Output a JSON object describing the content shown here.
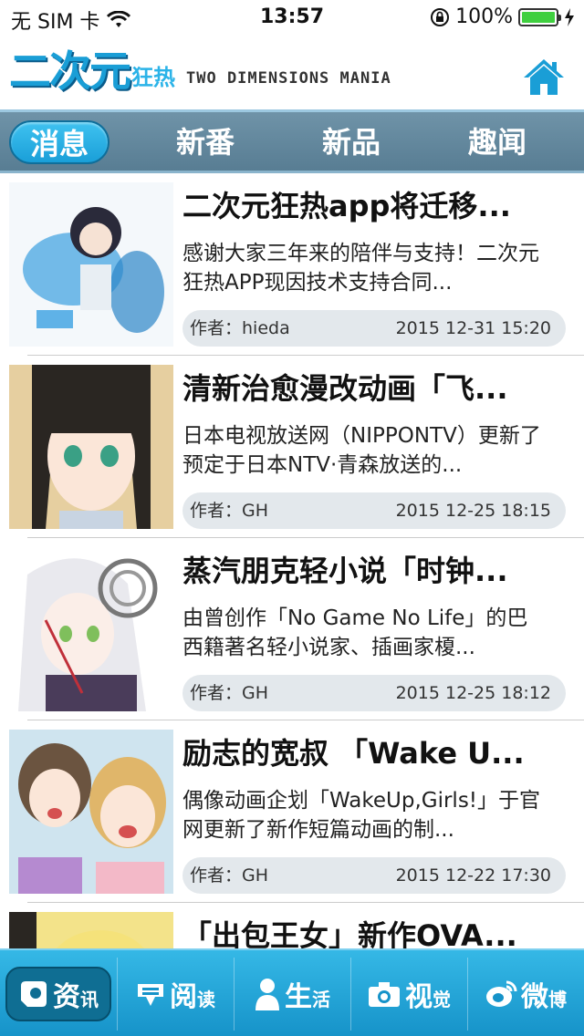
{
  "status_bar": {
    "carrier": "无 SIM 卡",
    "time": "13:57",
    "battery": "100%",
    "battery_level": 1.0
  },
  "header": {
    "logo_main": "二次元",
    "logo_sub": "狂热",
    "logo_en": "TWO DIMENSIONS MANIA",
    "home_icon": "home-icon"
  },
  "tabs": [
    {
      "label": "消息",
      "active": true
    },
    {
      "label": "新番",
      "active": false
    },
    {
      "label": "新品",
      "active": false
    },
    {
      "label": "趣闻",
      "active": false
    }
  ],
  "news": [
    {
      "title": "二次元狂热app将迁移...",
      "desc": "感谢大家三年来的陪伴与支持！二次元狂热APP现因技术支持合同...",
      "author": "作者：hieda",
      "date": "2015 12-31 15:20"
    },
    {
      "title": "清新治愈漫改动画「飞...",
      "desc": "日本电视放送网（NIPPONTV）更新了预定于日本NTV·青森放送的...",
      "author": "作者：GH",
      "date": "2015 12-25 18:15"
    },
    {
      "title": "蒸汽朋克轻小说「时钟...",
      "desc": "由曾创作「No Game No Life」的巴西籍著名轻小说家、插画家榎...",
      "author": "作者：GH",
      "date": "2015 12-25 18:12"
    },
    {
      "title": "励志的宽叔 「Wake U...",
      "desc": "偶像动画企划「WakeUp,Girls!」于官网更新了新作短篇动画的制...",
      "author": "作者：GH",
      "date": "2015 12-22 17:30"
    },
    {
      "title": "「出包王女」新作OVA...",
      "desc": "",
      "author": "",
      "date": ""
    }
  ],
  "bottom_nav": [
    {
      "big": "资",
      "small": "讯",
      "icon": "news-icon",
      "active": true
    },
    {
      "big": "阅",
      "small": "读",
      "icon": "read-icon",
      "active": false
    },
    {
      "big": "生",
      "small": "活",
      "icon": "person-icon",
      "active": false
    },
    {
      "big": "视",
      "small": "觉",
      "icon": "camera-icon",
      "active": false
    },
    {
      "big": "微",
      "small": "博",
      "icon": "weibo-icon",
      "active": false
    }
  ],
  "colors": {
    "accent": "#1a9ed6",
    "tab_bar": "#587d93",
    "meta_bg": "#e3e8ec",
    "battery": "#3fcf3f"
  }
}
